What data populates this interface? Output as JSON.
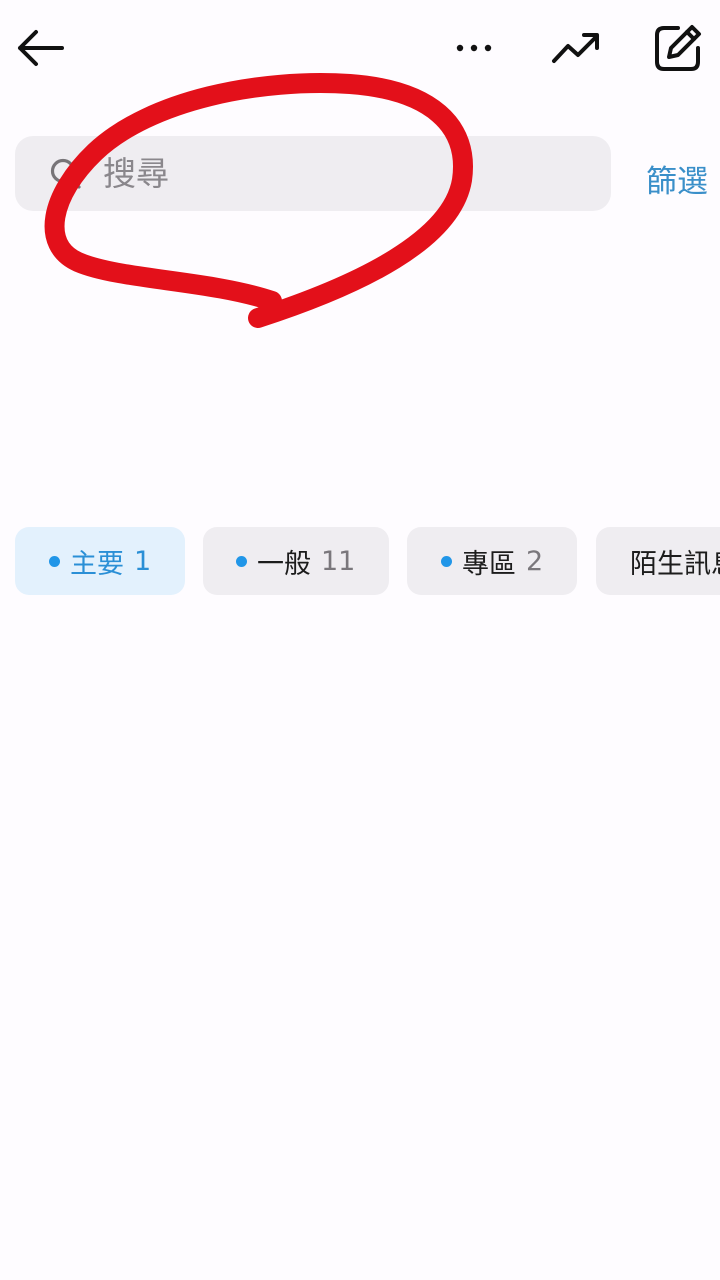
{
  "toolbar": {
    "back_icon": "arrow-left-icon",
    "more_icon": "more-horizontal-icon",
    "trend_icon": "trending-up-icon",
    "compose_icon": "edit-compose-icon"
  },
  "search": {
    "placeholder": "搜尋",
    "icon": "search-icon"
  },
  "filter": {
    "label": "篩選"
  },
  "tabs": [
    {
      "label": "主要",
      "count": "1",
      "active": true
    },
    {
      "label": "一般",
      "count": "11",
      "active": false
    },
    {
      "label": "專區",
      "count": "2",
      "active": false
    },
    {
      "label": "陌生訊息",
      "count": "",
      "active": false
    }
  ],
  "colors": {
    "accent": "#2196e8",
    "active_tab_bg": "#e3f1fd",
    "tab_bg": "#efedf1",
    "filter_text": "#3a8fc9",
    "annotation": "#e3101a"
  }
}
